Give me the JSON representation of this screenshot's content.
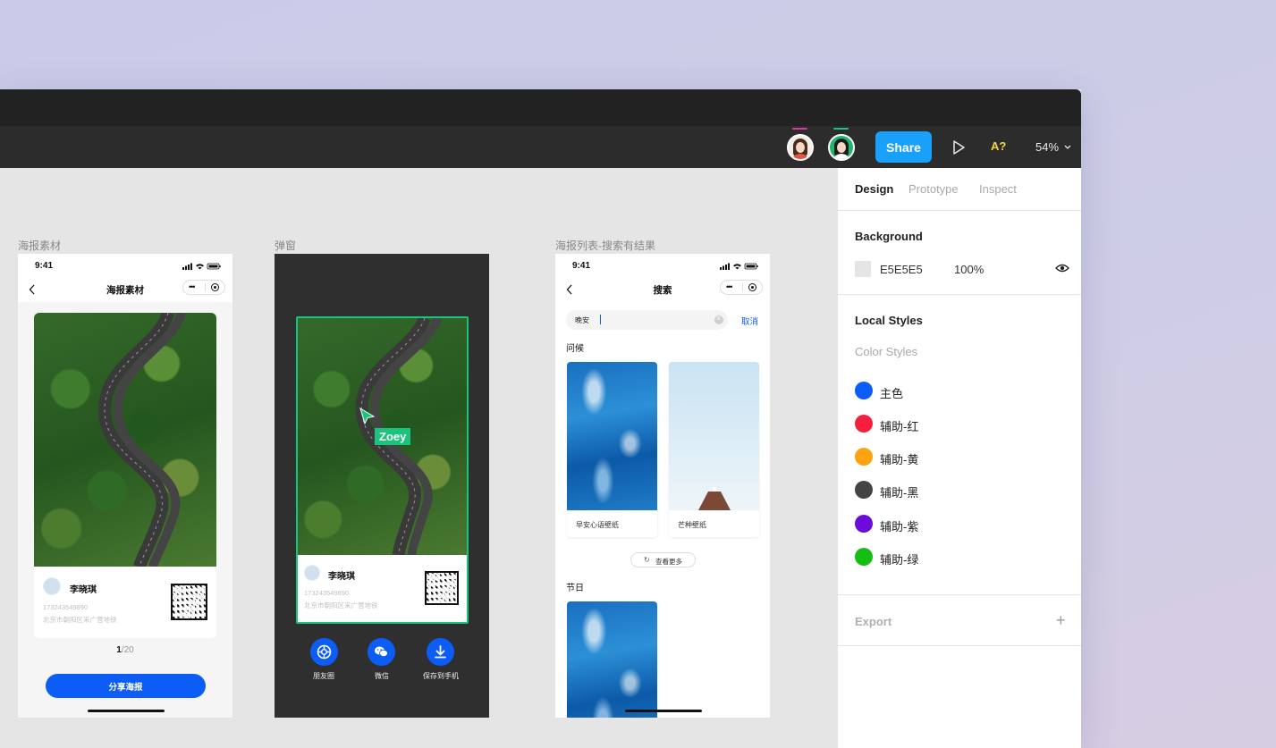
{
  "toolbar": {
    "share_label": "Share",
    "a_label": "A?",
    "zoom_label": "54%",
    "collaborators": [
      {
        "name": "collaborator-1",
        "bar_color": "#e236a8"
      },
      {
        "name": "collaborator-2",
        "bar_color": "#1bc47d"
      }
    ]
  },
  "canvas": {
    "frame1": {
      "label": "海报素材",
      "time": "9:41",
      "title": "海报素材",
      "user_name": "李晓琪",
      "user_phone": "173243549890",
      "user_address": "北京市朝阳区来广营地铁",
      "pager_current": "1",
      "pager_total": "/20",
      "button_label": "分享海报"
    },
    "frame2": {
      "label": "弹窗",
      "user_name": "李晓琪",
      "user_phone": "173243549890",
      "user_address": "北京市朝阳区来广营地铁",
      "cursor_name": "Zoey",
      "actions": [
        {
          "label": "朋友圈",
          "icon": "moments-icon"
        },
        {
          "label": "微信",
          "icon": "wechat-icon"
        },
        {
          "label": "保存到手机",
          "icon": "download-icon"
        }
      ]
    },
    "frame3": {
      "label": "海报列表-搜索有结果",
      "time": "9:41",
      "title": "搜索",
      "search_value": "晚安",
      "cancel_label": "取消",
      "section1_title": "问候",
      "tiles": [
        {
          "caption": "早安心语壁纸"
        },
        {
          "caption": "芒种壁纸"
        }
      ],
      "more_label": "查看更多",
      "more_icon": "refresh-icon",
      "section2_title": "节日"
    }
  },
  "panel": {
    "tabs": [
      "Design",
      "Prototype",
      "Inspect"
    ],
    "active_tab": "Design",
    "background_title": "Background",
    "background_hex": "E5E5E5",
    "background_opacity": "100%",
    "local_styles_title": "Local Styles",
    "color_styles_label": "Color Styles",
    "color_styles": [
      {
        "name": "主色",
        "color": "#0c5cf6"
      },
      {
        "name": "辅助-红",
        "color": "#f5203f"
      },
      {
        "name": "辅助-黄",
        "color": "#fca311"
      },
      {
        "name": "辅助-黑",
        "color": "#444444"
      },
      {
        "name": "辅助-紫",
        "color": "#6b0cdc"
      },
      {
        "name": "辅助-绿",
        "color": "#14be14"
      }
    ],
    "export_label": "Export"
  }
}
